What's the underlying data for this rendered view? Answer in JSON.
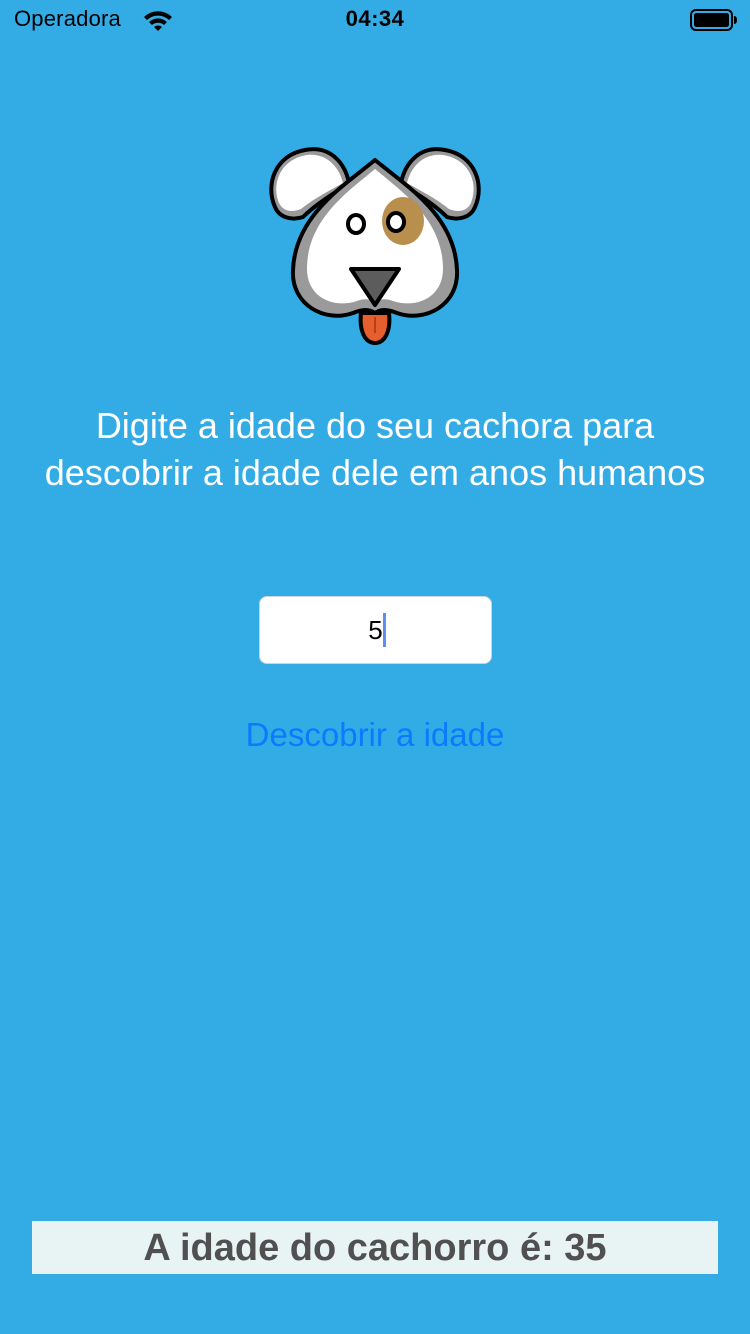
{
  "status_bar": {
    "carrier": "Operadora",
    "time": "04:34",
    "wifi_icon": "wifi-icon",
    "battery_icon": "battery-full-icon"
  },
  "logo": {
    "icon": "dog-face-icon"
  },
  "instruction_text": "Digite a idade do seu cachora para descobrir a idade dele em anos humanos",
  "age_input": {
    "value": "5",
    "placeholder": ""
  },
  "discover_button_label": "Descobrir a idade",
  "result": {
    "label": "A idade do cachorro é: 35"
  },
  "colors": {
    "background": "#33ace6",
    "button_text": "#0a7bff",
    "instruction_text": "#ffffff",
    "result_bg": "#e8f3f4",
    "result_text": "#505050",
    "dog_ear_spot": "#b98f4e",
    "dog_tongue": "#e65d2e"
  }
}
